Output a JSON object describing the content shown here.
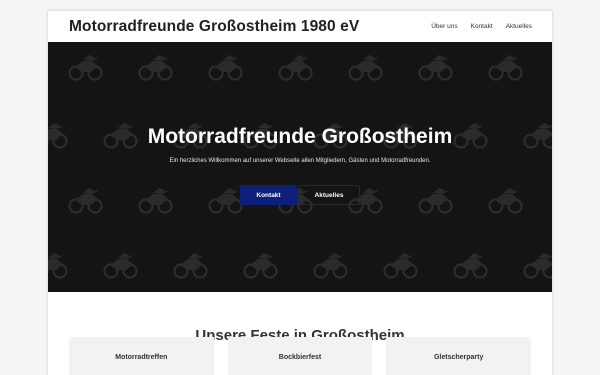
{
  "header": {
    "brand": "Motorradfreunde Großostheim 1980 eV",
    "nav": [
      "Über uns",
      "Kontakt",
      "Aktuelles"
    ]
  },
  "hero": {
    "title": "Motorradfreunde Großostheim",
    "subtitle": "Ein herzliches Willkommen auf unserer Webseite allen Mitgliedern, Gästen und Motorradfreunden.",
    "primary_button": "Kontakt",
    "secondary_button": "Aktuelles",
    "background_icon": "motorcycle-icon"
  },
  "festivals": {
    "title": "Unsere Feste in Großostheim",
    "cards": [
      "Motorradtreffen",
      "Bockbierfest",
      "Gletscherparty"
    ]
  },
  "colors": {
    "hero_background": "#141414",
    "primary_button": "#0e1f7a",
    "card_background": "#f2f2f2"
  }
}
